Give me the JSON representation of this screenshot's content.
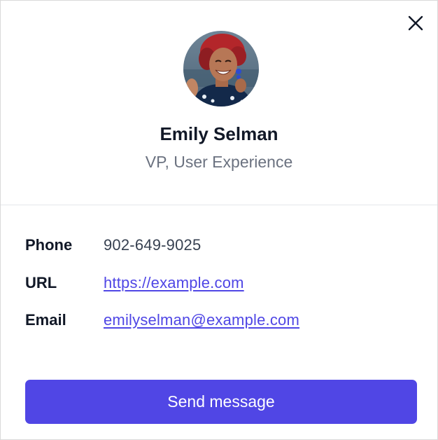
{
  "profile": {
    "name": "Emily Selman",
    "title": "VP, User Experience",
    "avatar_icon": "person-avatar"
  },
  "details": {
    "phone": {
      "label": "Phone",
      "value": "902-649-9025"
    },
    "url": {
      "label": "URL",
      "value": "https://example.com"
    },
    "email": {
      "label": "Email",
      "value": "emilyselman@example.com"
    }
  },
  "actions": {
    "send_label": "Send message",
    "close_icon": "close-icon"
  },
  "colors": {
    "accent": "#5046e5",
    "link": "#4f46e5",
    "muted": "#6b7280",
    "text": "#111827"
  }
}
